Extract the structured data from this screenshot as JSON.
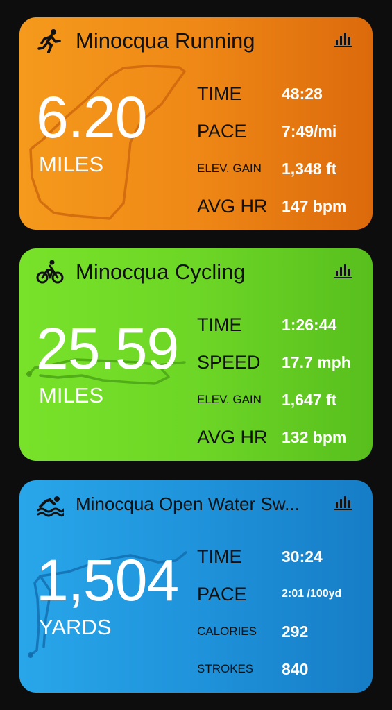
{
  "cards": [
    {
      "activity": "running",
      "title": "Minocqua Running",
      "distance": "6.20",
      "unit": "MILES",
      "stats": [
        {
          "label": "TIME",
          "value": "48:28"
        },
        {
          "label": "PACE",
          "value": "7:49/mi"
        },
        {
          "label": "ELEV. GAIN",
          "value": "1,348 ft"
        },
        {
          "label": "AVG HR",
          "value": "147 bpm"
        }
      ],
      "color": "#ef8816"
    },
    {
      "activity": "cycling",
      "title": "Minocqua Cycling",
      "distance": "25.59",
      "unit": "MILES",
      "stats": [
        {
          "label": "TIME",
          "value": "1:26:44"
        },
        {
          "label": "SPEED",
          "value": "17.7 mph"
        },
        {
          "label": "ELEV. GAIN",
          "value": "1,647 ft"
        },
        {
          "label": "AVG HR",
          "value": "132 bpm"
        }
      ],
      "color": "#6dd626"
    },
    {
      "activity": "swimming",
      "title": "Minocqua Open Water Sw...",
      "distance": "1,504",
      "unit": "YARDS",
      "stats": [
        {
          "label": "TIME",
          "value": "30:24"
        },
        {
          "label": "PACE",
          "value": "2:01 /100yd"
        },
        {
          "label": "CALORIES",
          "value": "292"
        },
        {
          "label": "STROKES",
          "value": "840"
        }
      ],
      "color": "#1f93db"
    }
  ],
  "icons": {
    "running": "runner-icon",
    "cycling": "bicycle-icon",
    "swimming": "swimmer-icon",
    "chart": "bar-chart-icon"
  }
}
